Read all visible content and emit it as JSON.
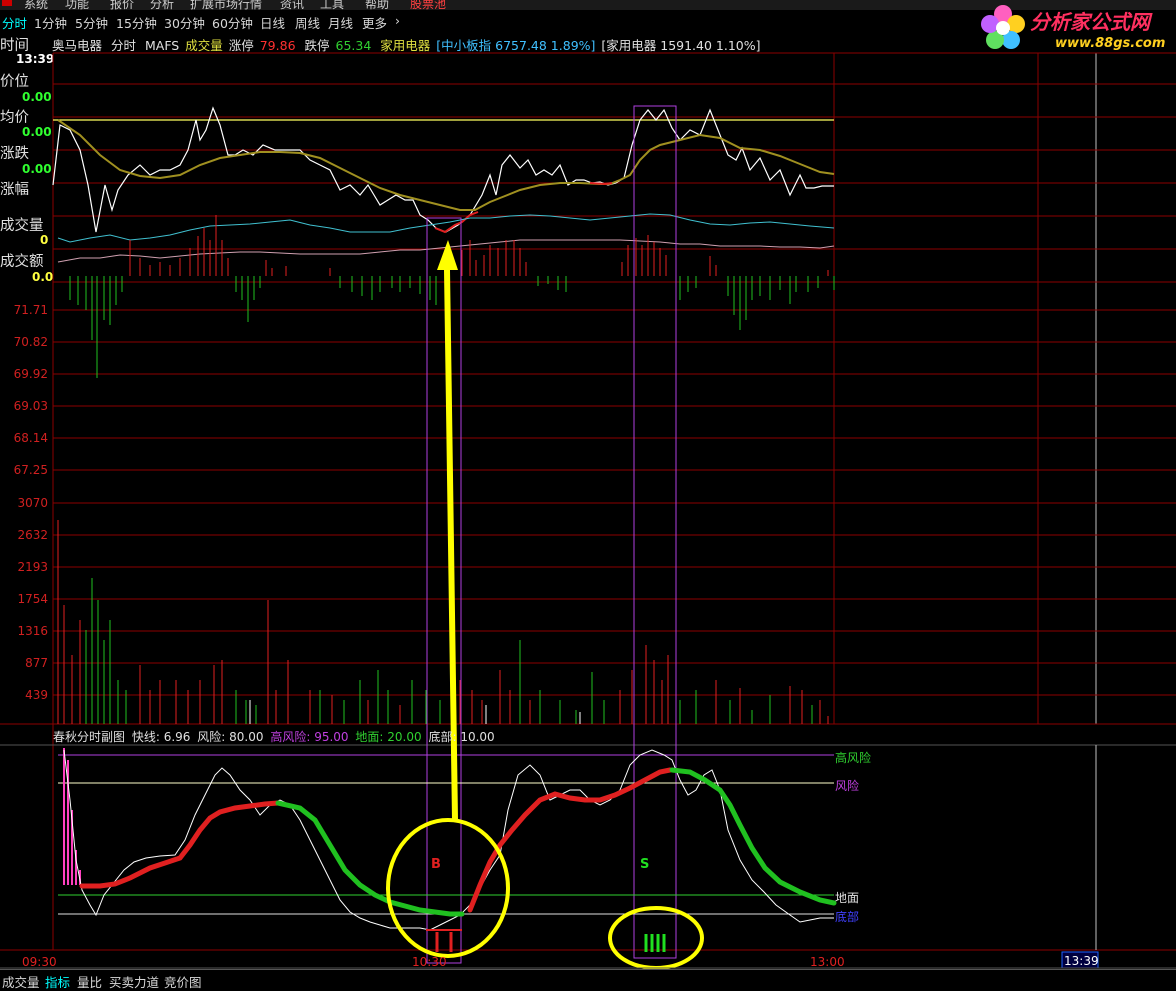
{
  "menubar": {
    "items": [
      "系统",
      "功能",
      "报价",
      "分析",
      "扩展市场行情",
      "资讯",
      "工具",
      "帮助",
      "股票池"
    ]
  },
  "periods": {
    "items": [
      "分时",
      "1分钟",
      "5分钟",
      "15分钟",
      "30分钟",
      "60分钟",
      "日线",
      "周线",
      "月线",
      "更多"
    ],
    "more_arrow": "›"
  },
  "logo": {
    "title": "分析家公式网",
    "url": "www.88gs.com",
    "icon": "flower-icon"
  },
  "info": {
    "name": "奥马电器",
    "mode": "分时",
    "indicator": "MAFS",
    "vol_label": "成交量",
    "limit_up_label": "涨停",
    "limit_up": "79.86",
    "limit_down_label": "跌停",
    "limit_down": "65.34",
    "sector": "家用电器",
    "index1": "[中小板指 6757.48 1.89%]",
    "index2": "[家用电器 1591.40 1.10%]"
  },
  "side": {
    "time_label": "时间",
    "time_value": "13:39",
    "price_label": "价位",
    "price_value": "0.00",
    "avg_label": "均价",
    "avg_value": "0.00",
    "chg_label": "涨跌",
    "chg_value": "0.00",
    "pct_label": "涨幅",
    "vol_label": "成交量",
    "vol_value": "0",
    "amt_label": "成交额",
    "amt_value": "0.0"
  },
  "price_axis": [
    "71.71",
    "70.82",
    "69.92",
    "69.03",
    "68.14",
    "67.25"
  ],
  "volume_axis": [
    "3070",
    "2632",
    "2193",
    "1754",
    "1316",
    "877",
    "439"
  ],
  "indicator": {
    "name": "春秋分时副图",
    "fast_label": "快线:",
    "fast": "6.96",
    "risk_label": "风险:",
    "risk": "80.00",
    "high_risk_label": "高风险:",
    "high_risk": "95.00",
    "ground_label": "地面:",
    "ground": "20.00",
    "bottom_label": "底部:",
    "bottom": "10.00",
    "right_labels": {
      "high_risk": "高风险",
      "risk": "风险",
      "ground": "地面",
      "bottom": "底部"
    },
    "buy_mark": "B",
    "sell_mark": "S"
  },
  "time_axis": [
    "09:30",
    "10:30",
    "13:00"
  ],
  "cursor_time": "13:39",
  "bottom_tabs": [
    "成交量",
    "指标",
    "量比",
    "买卖力道",
    "竞价图"
  ],
  "colors": {
    "grid": "#8b0000",
    "up": "#ff2020",
    "down": "#20c020",
    "accent": "#00ffff",
    "highlight": "#ffff00",
    "box": "#b040e0"
  }
}
